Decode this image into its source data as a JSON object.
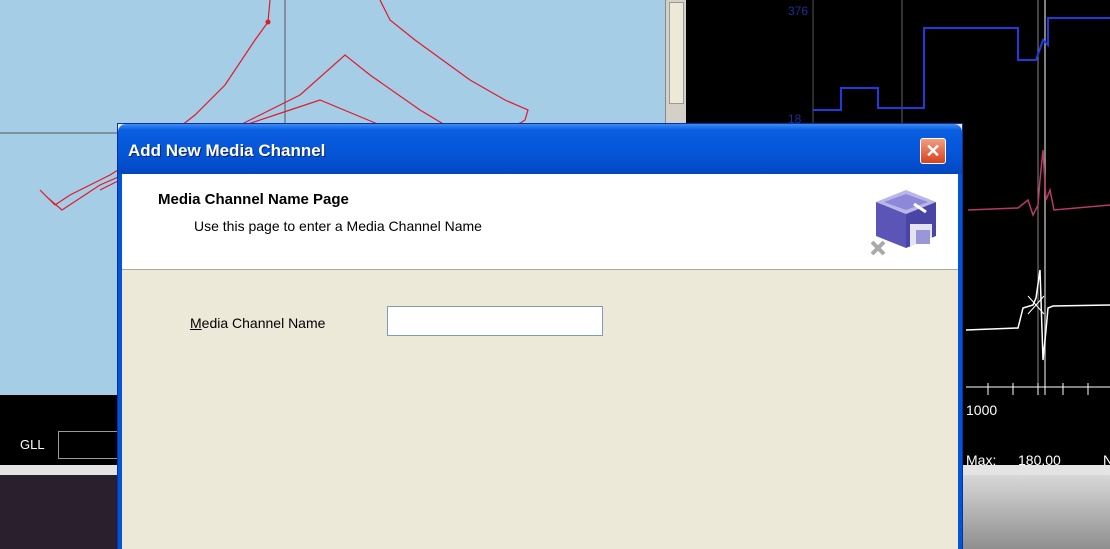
{
  "background": {
    "gll_label": "GLL",
    "chart_labels": {
      "top": "376",
      "mid": "18",
      "tick_1000": "1000",
      "max_label": "Max:",
      "max_value": "180.00",
      "trunc": "N"
    }
  },
  "dialog": {
    "title": "Add New Media Channel",
    "close_glyph": "✕",
    "header": {
      "page_title": "Media Channel Name Page",
      "page_subtitle": "Use this page to enter a Media Channel Name",
      "icon": "wizard-cube-icon"
    },
    "form": {
      "name_label_prefix": "M",
      "name_label_rest": "edia Channel Name",
      "name_value": ""
    }
  },
  "colors": {
    "titlebar": "#0455d8",
    "dialog_bg": "#ece9d8",
    "map_bg": "#a6cde6",
    "track": "#e0192b",
    "series_blue": "#1e3be0",
    "series_pink": "#b83a66"
  }
}
